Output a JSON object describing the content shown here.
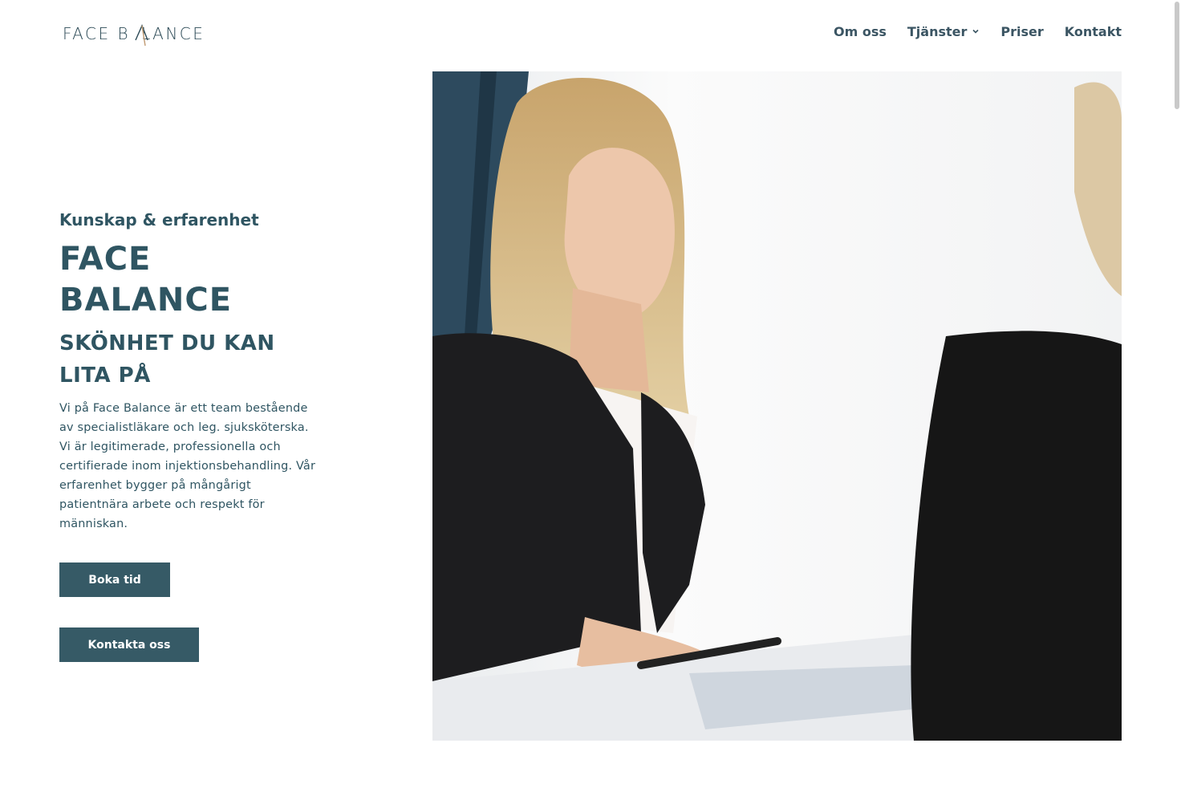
{
  "header": {
    "logo_text_left": "FACE B",
    "logo_text_right": "LANCE",
    "nav": [
      {
        "label": "Om oss"
      },
      {
        "label": "Tjänster",
        "has_dropdown": true
      },
      {
        "label": "Priser"
      },
      {
        "label": "Kontakt"
      }
    ]
  },
  "hero": {
    "kicker": "Kunskap & erfarenhet",
    "title_line1": "FACE",
    "title_line2": "BALANCE",
    "subtitle_line1": "SKÖNHET DU KAN",
    "subtitle_line2": "LITA PÅ",
    "intro": "Vi på Face Balance är ett team bestående av specialistläkare och leg. sjuksköterska. Vi är legitimerade, professionella och certifierade inom injektionsbehandling. Vår erfarenhet bygger på mångårigt patientnära arbete och respekt för människan.",
    "book_button": "Boka tid",
    "contact_button": "Kontakta oss"
  },
  "colors": {
    "primary": "#365a66",
    "text": "#2f5562",
    "logo_accent": "#c09a72",
    "background": "#ffffff"
  },
  "icons": {
    "dropdown": "chevron-down-icon",
    "logo_mark": "logo-a-mark-icon"
  }
}
